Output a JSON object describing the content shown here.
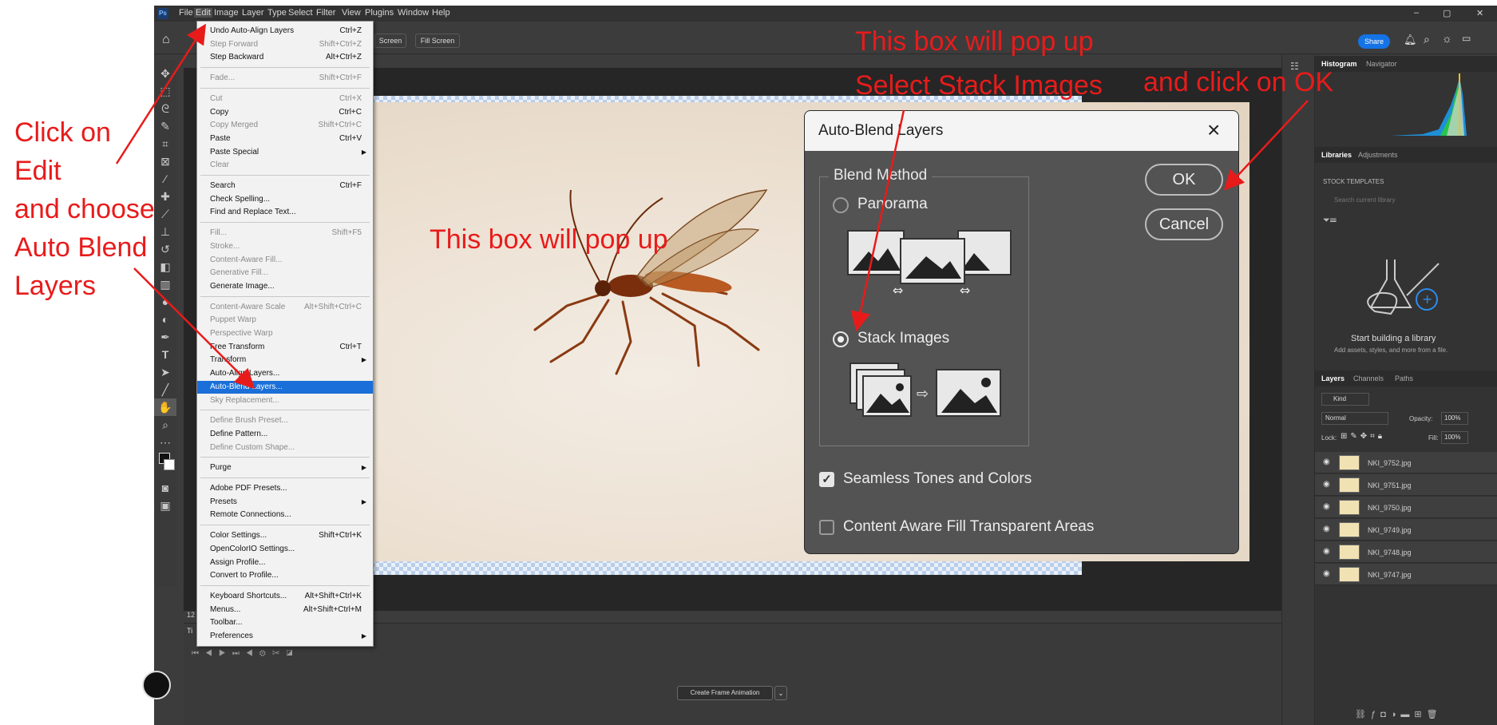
{
  "menubar": {
    "ps_logo": "Ps",
    "items": [
      "File",
      "Edit",
      "Image",
      "Layer",
      "Type",
      "Select",
      "Filter",
      "View",
      "Plugins",
      "Window",
      "Help"
    ]
  },
  "window_controls": {
    "minimize": "–",
    "restore": "▢",
    "close": "✕"
  },
  "optbar": {
    "screen_btn": "Screen",
    "fill_screen_btn": "Fill Screen",
    "share_btn": "Share"
  },
  "edit_menu": {
    "items": [
      {
        "label": "Undo Auto-Align Layers",
        "shortcut": "Ctrl+Z",
        "disabled": false
      },
      {
        "label": "Step Forward",
        "shortcut": "Shift+Ctrl+Z",
        "disabled": true
      },
      {
        "label": "Step Backward",
        "shortcut": "Alt+Ctrl+Z",
        "disabled": false
      },
      {
        "label": "Fade...",
        "shortcut": "Shift+Ctrl+F",
        "disabled": true
      },
      {
        "label": "Cut",
        "shortcut": "Ctrl+X",
        "disabled": true
      },
      {
        "label": "Copy",
        "shortcut": "Ctrl+C",
        "disabled": false
      },
      {
        "label": "Copy Merged",
        "shortcut": "Shift+Ctrl+C",
        "disabled": true
      },
      {
        "label": "Paste",
        "shortcut": "Ctrl+V",
        "disabled": false
      },
      {
        "label": "Paste Special",
        "shortcut": "",
        "disabled": false,
        "submenu": true
      },
      {
        "label": "Clear",
        "shortcut": "",
        "disabled": true
      },
      {
        "label": "Search",
        "shortcut": "Ctrl+F",
        "disabled": false
      },
      {
        "label": "Check Spelling...",
        "shortcut": "",
        "disabled": false
      },
      {
        "label": "Find and Replace Text...",
        "shortcut": "",
        "disabled": false
      },
      {
        "label": "Fill...",
        "shortcut": "Shift+F5",
        "disabled": true
      },
      {
        "label": "Stroke...",
        "shortcut": "",
        "disabled": true
      },
      {
        "label": "Content-Aware Fill...",
        "shortcut": "",
        "disabled": true
      },
      {
        "label": "Generative Fill...",
        "shortcut": "",
        "disabled": true
      },
      {
        "label": "Generate Image...",
        "shortcut": "",
        "disabled": false
      },
      {
        "label": "Content-Aware Scale",
        "shortcut": "Alt+Shift+Ctrl+C",
        "disabled": true
      },
      {
        "label": "Puppet Warp",
        "shortcut": "",
        "disabled": true
      },
      {
        "label": "Perspective Warp",
        "shortcut": "",
        "disabled": true
      },
      {
        "label": "Free Transform",
        "shortcut": "Ctrl+T",
        "disabled": false
      },
      {
        "label": "Transform",
        "shortcut": "",
        "disabled": false,
        "submenu": true
      },
      {
        "label": "Auto-Align Layers...",
        "shortcut": "",
        "disabled": false
      },
      {
        "label": "Auto-Blend Layers...",
        "shortcut": "",
        "disabled": false,
        "highlighted": true
      },
      {
        "label": "Sky Replacement...",
        "shortcut": "",
        "disabled": true
      },
      {
        "label": "Define Brush Preset...",
        "shortcut": "",
        "disabled": true
      },
      {
        "label": "Define Pattern...",
        "shortcut": "",
        "disabled": false
      },
      {
        "label": "Define Custom Shape...",
        "shortcut": "",
        "disabled": true
      },
      {
        "label": "Purge",
        "shortcut": "",
        "disabled": false,
        "submenu": true
      },
      {
        "label": "Adobe PDF Presets...",
        "shortcut": "",
        "disabled": false
      },
      {
        "label": "Presets",
        "shortcut": "",
        "disabled": false,
        "submenu": true
      },
      {
        "label": "Remote Connections...",
        "shortcut": "",
        "disabled": false
      },
      {
        "label": "Color Settings...",
        "shortcut": "Shift+Ctrl+K",
        "disabled": false
      },
      {
        "label": "OpenColorIO Settings...",
        "shortcut": "",
        "disabled": false
      },
      {
        "label": "Assign Profile...",
        "shortcut": "",
        "disabled": false
      },
      {
        "label": "Convert to Profile...",
        "shortcut": "",
        "disabled": false
      },
      {
        "label": "Keyboard Shortcuts...",
        "shortcut": "Alt+Shift+Ctrl+K",
        "disabled": false
      },
      {
        "label": "Menus...",
        "shortcut": "Alt+Shift+Ctrl+M",
        "disabled": false
      },
      {
        "label": "Toolbar...",
        "shortcut": "",
        "disabled": false
      },
      {
        "label": "Preferences",
        "shortcut": "",
        "disabled": false,
        "submenu": true
      }
    ]
  },
  "dialog": {
    "title": "Auto-Blend Layers",
    "group_label": "Blend Method",
    "options": [
      {
        "label": "Panorama",
        "selected": false
      },
      {
        "label": "Stack Images",
        "selected": true
      }
    ],
    "ok": "OK",
    "cancel": "Cancel",
    "checkboxes": [
      {
        "label": "Seamless Tones and Colors",
        "checked": true
      },
      {
        "label": "Content Aware Fill Transparent Areas",
        "checked": false
      }
    ]
  },
  "panels": {
    "top_tabs": [
      "Histogram",
      "Navigator"
    ],
    "lib_tabs": [
      "Libraries",
      "Adjustments"
    ],
    "stock_templates": "STOCK TEMPLATES",
    "search_placeholder": "Search current library",
    "lib_empty_title": "Start building a library",
    "lib_empty_sub": "Add assets, styles, and more from a file.",
    "layer_tabs": [
      "Layers",
      "Channels",
      "Paths"
    ],
    "kind": "Kind",
    "blend_mode": "Normal",
    "opacity_label": "Opacity:",
    "opacity_value": "100%",
    "lock_label": "Lock:",
    "fill_label": "Fill:",
    "fill_value": "100%",
    "layers": [
      "NKI_9752.jpg",
      "NKI_9751.jpg",
      "NKI_9750.jpg",
      "NKI_9749.jpg",
      "NKI_9748.jpg",
      "NKI_9747.jpg"
    ]
  },
  "timeline": {
    "label": "Ti",
    "create_btn": "Create Frame Animation",
    "zoom_fragment": "12"
  },
  "annotations": {
    "left": [
      "Click  on",
      "Edit",
      "and choose",
      "Auto Blend",
      "Layers"
    ],
    "popup_center": "This box will pop up",
    "popup_top": "This box will pop up",
    "select_stack": "Select Stack Images",
    "click_ok": "and click on OK"
  },
  "colors": {
    "annotation": "#e81b1b",
    "menu_highlight": "#1a6fd8",
    "share": "#1473e6"
  }
}
